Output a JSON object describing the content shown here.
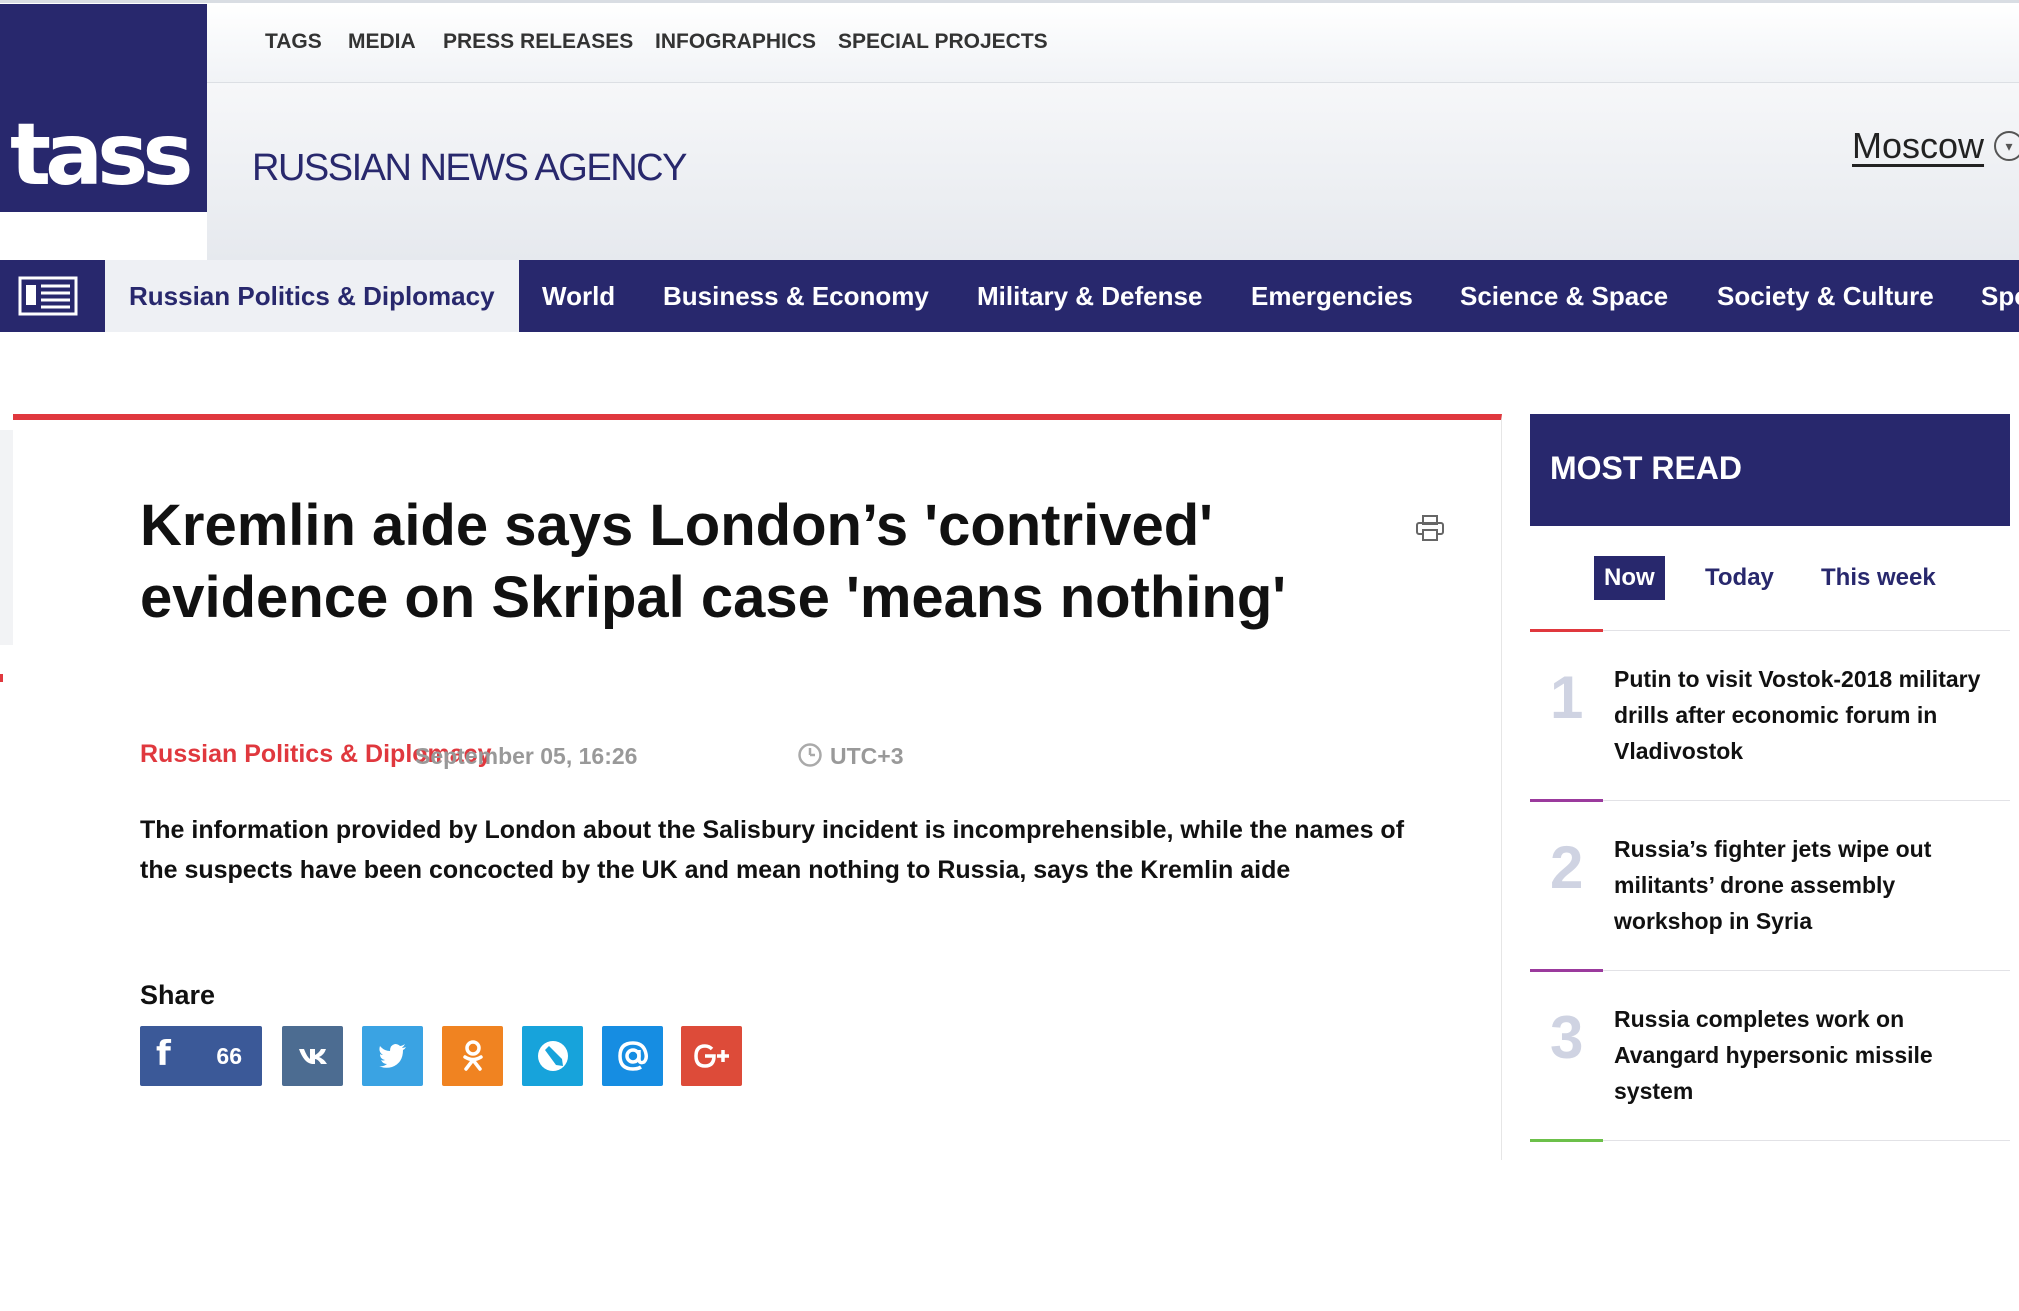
{
  "header": {
    "logo": "tass",
    "top_links": [
      "TAGS",
      "MEDIA",
      "PRESS RELEASES",
      "INFOGRAPHICS",
      "SPECIAL PROJECTS"
    ],
    "agency_name": "RUSSIAN NEWS AGENCY",
    "city": "Moscow"
  },
  "nav": {
    "items": [
      "Russian Politics & Diplomacy",
      "World",
      "Business & Economy",
      "Military & Defense",
      "Emergencies",
      "Science & Space",
      "Society & Culture",
      "Spo"
    ],
    "active_index": 0
  },
  "article": {
    "headline": "Kremlin aide says London’s 'contrived' evidence on Skripal case 'means nothing'",
    "category": "Russian Politics & Diplomacy",
    "date": "September 05, 16:26",
    "timezone": "UTC+3",
    "lead": "The information provided by London about the Salisbury incident is incomprehensible, while the names of the suspects have been concocted by the UK and mean nothing to Russia, says the Kremlin aide",
    "share_label": "Share",
    "share_buttons": [
      {
        "network": "facebook-icon",
        "count": "66",
        "color": "#3b5998"
      },
      {
        "network": "vk-icon",
        "color": "#4c6c91"
      },
      {
        "network": "twitter-icon",
        "color": "#3aa3e3"
      },
      {
        "network": "odnoklassniki-icon",
        "color": "#f08321"
      },
      {
        "network": "livejournal-icon",
        "color": "#17a3db"
      },
      {
        "network": "mail-icon",
        "color": "#168de2"
      },
      {
        "network": "google-plus-icon",
        "color": "#dd4b39"
      }
    ]
  },
  "most_read": {
    "title": "MOST READ",
    "tabs": [
      "Now",
      "Today",
      "This week"
    ],
    "active_tab": 0,
    "items": [
      {
        "rank": "1",
        "text": "Putin to visit Vostok-2018 military drills after economic forum in Vladivostok",
        "accent": "#e0383e"
      },
      {
        "rank": "2",
        "text": "Russia’s fighter jets wipe out militants’ drone assembly workshop in Syria",
        "accent": "#9b3a9d"
      },
      {
        "rank": "3",
        "text": "Russia completes work on Avangard hypersonic missile system",
        "accent": "#9b3a9d"
      }
    ],
    "next_accent": "#6cc04a"
  },
  "colors": {
    "brand_navy": "#28286d",
    "accent_red": "#e0383e",
    "nav_active_bg": "#eef0f4"
  }
}
